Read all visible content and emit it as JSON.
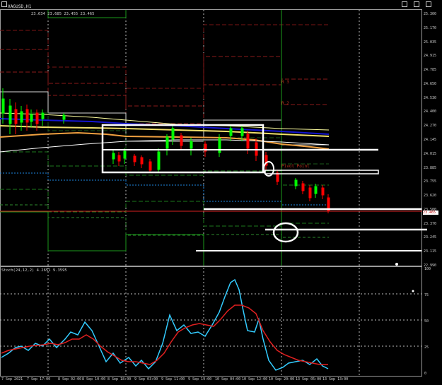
{
  "symbol": "XAGUSD,H1",
  "ohlc": "23.634 23.685 23.455 23.465",
  "stoch": {
    "label": "Stoch(24,12,2) 4.2651 9.3595",
    "ticks": [
      "100",
      "75",
      "50",
      "25",
      "0"
    ]
  },
  "price_ticks": [
    "25.300",
    "25.170",
    "25.035",
    "24.915",
    "24.785",
    "24.650",
    "24.530",
    "24.400",
    "24.270",
    "24.145",
    "24.015",
    "23.885",
    "23.755",
    "23.620",
    "23.500",
    "23.370",
    "23.245",
    "23.115",
    "22.990"
  ],
  "current_price": "23.465",
  "time_ticks": [
    "7 Sep 2021",
    "7 Sep 17:00",
    "8 Sep 02:00",
    "8 Sep 10:00",
    "8 Sep 18:00",
    "9 Sep 03:00",
    "9 Sep 11:00",
    "9 Sep 19:00",
    "10 Sep 04:00",
    "10 Sep 12:00",
    "10 Sep 20:00",
    "13 Sep 05:00",
    "13 Sep 13:00"
  ],
  "levels": {
    "r3": "R 3",
    "r2": "R 2",
    "pivot": "Pivot Point"
  },
  "colors": {
    "up": "#00ff00",
    "down": "#ff0000",
    "stoch_main": "#33ccff",
    "stoch_signal": "#e02020"
  }
}
